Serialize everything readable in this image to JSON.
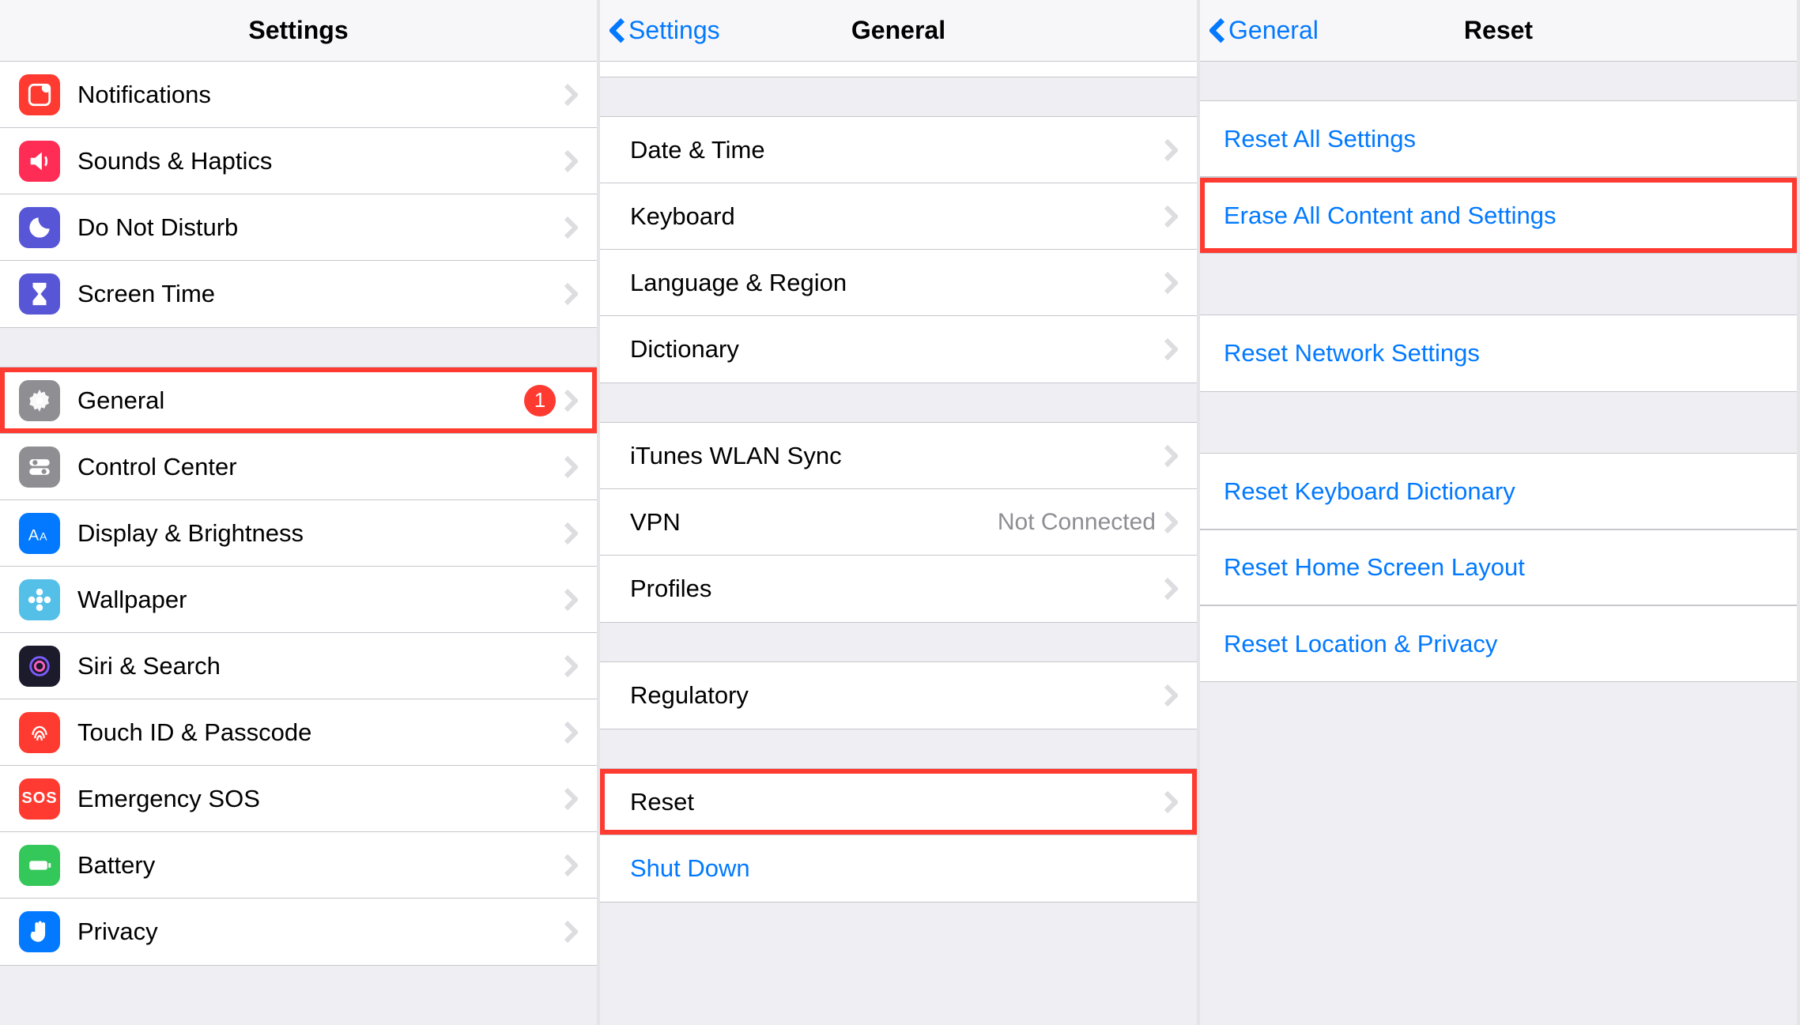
{
  "panel1": {
    "title": "Settings",
    "group1": [
      {
        "key": "notifications",
        "label": "Notifications",
        "iconClass": "ic-notif"
      },
      {
        "key": "sounds",
        "label": "Sounds & Haptics",
        "iconClass": "ic-sound"
      },
      {
        "key": "dnd",
        "label": "Do Not Disturb",
        "iconClass": "ic-dnd"
      },
      {
        "key": "screentime",
        "label": "Screen Time",
        "iconClass": "ic-screentime"
      }
    ],
    "group2": [
      {
        "key": "general",
        "label": "General",
        "iconClass": "ic-general",
        "badge": "1",
        "highlight": true
      },
      {
        "key": "controlcenter",
        "label": "Control Center",
        "iconClass": "ic-cc"
      },
      {
        "key": "display",
        "label": "Display & Brightness",
        "iconClass": "ic-display"
      },
      {
        "key": "wallpaper",
        "label": "Wallpaper",
        "iconClass": "ic-wall"
      },
      {
        "key": "siri",
        "label": "Siri & Search",
        "iconClass": "ic-siri"
      },
      {
        "key": "touchid",
        "label": "Touch ID & Passcode",
        "iconClass": "ic-touchid"
      },
      {
        "key": "sos",
        "label": "Emergency SOS",
        "iconClass": "ic-sos"
      },
      {
        "key": "battery",
        "label": "Battery",
        "iconClass": "ic-battery"
      },
      {
        "key": "privacy",
        "label": "Privacy",
        "iconClass": "ic-privacy"
      }
    ]
  },
  "panel2": {
    "back": "Settings",
    "title": "General",
    "group1": [
      {
        "key": "datetime",
        "label": "Date & Time"
      },
      {
        "key": "keyboard",
        "label": "Keyboard"
      },
      {
        "key": "langregion",
        "label": "Language & Region"
      },
      {
        "key": "dictionary",
        "label": "Dictionary"
      }
    ],
    "group2": [
      {
        "key": "ituneswlan",
        "label": "iTunes WLAN Sync"
      },
      {
        "key": "vpn",
        "label": "VPN",
        "detail": "Not Connected"
      },
      {
        "key": "profiles",
        "label": "Profiles"
      }
    ],
    "regulatory": {
      "label": "Regulatory"
    },
    "reset": {
      "label": "Reset",
      "highlight": true
    },
    "shutdown": {
      "label": "Shut Down"
    }
  },
  "panel3": {
    "back": "General",
    "title": "Reset",
    "group1": [
      {
        "key": "resetall",
        "label": "Reset All Settings"
      },
      {
        "key": "eraseall",
        "label": "Erase All Content and Settings",
        "highlight": true
      }
    ],
    "group2": [
      {
        "key": "resetnetwork",
        "label": "Reset Network Settings"
      }
    ],
    "group3": [
      {
        "key": "resetkeyboard",
        "label": "Reset Keyboard Dictionary"
      },
      {
        "key": "resethome",
        "label": "Reset Home Screen Layout"
      },
      {
        "key": "resetlocation",
        "label": "Reset Location & Privacy"
      }
    ]
  }
}
